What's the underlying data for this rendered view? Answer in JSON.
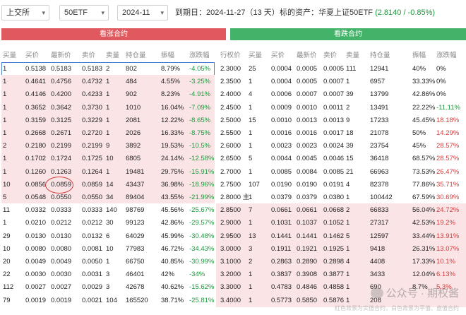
{
  "topbar": {
    "exchange": "上交所",
    "underlying": "50ETF",
    "month": "2024-11",
    "expiry_label": "到期日：",
    "expiry_date": "2024-11-27",
    "days_left": "（13 天）",
    "asset_label": "标的资产：",
    "asset_name": "华夏上证50ETF",
    "asset_quote": "(2.8140 / -0.85%)"
  },
  "headers": {
    "call": "看涨合约",
    "put": "看跌合约"
  },
  "call_columns": [
    "买量",
    "买价",
    "最新价",
    "卖价",
    "卖量",
    "持仓量",
    "振幅",
    "涨跌幅"
  ],
  "put_columns": [
    "行权价",
    "买量",
    "买价",
    "最新价",
    "卖价",
    "卖量",
    "持仓量",
    "振幅",
    "涨跌幅"
  ],
  "calls": [
    [
      "1",
      "0.5138",
      "0.5183",
      "0.5183",
      "2",
      "802",
      "8.79%",
      "-4.05%"
    ],
    [
      "1",
      "0.4641",
      "0.4756",
      "0.4732",
      "1",
      "484",
      "4.55%",
      "-3.25%"
    ],
    [
      "1",
      "0.4146",
      "0.4200",
      "0.4233",
      "1",
      "902",
      "8.23%",
      "-4.91%"
    ],
    [
      "1",
      "0.3652",
      "0.3642",
      "0.3730",
      "1",
      "1010",
      "16.04%",
      "-7.09%"
    ],
    [
      "1",
      "0.3159",
      "0.3125",
      "0.3229",
      "1",
      "2081",
      "12.22%",
      "-8.65%"
    ],
    [
      "1",
      "0.2668",
      "0.2671",
      "0.2720",
      "1",
      "2026",
      "16.33%",
      "-8.75%"
    ],
    [
      "2",
      "0.2180",
      "0.2199",
      "0.2199",
      "9",
      "3892",
      "19.53%",
      "-10.5%"
    ],
    [
      "1",
      "0.1702",
      "0.1724",
      "0.1725",
      "10",
      "6805",
      "24.14%",
      "-12.58%"
    ],
    [
      "1",
      "0.1260",
      "0.1263",
      "0.1264",
      "1",
      "19481",
      "29.75%",
      "-15.91%"
    ],
    [
      "10",
      "0.0856",
      "0.0859",
      "0.0859",
      "14",
      "43437",
      "36.98%",
      "-18.96%"
    ],
    [
      "5",
      "0.0548",
      "0.0550",
      "0.0550",
      "34",
      "89404",
      "43.55%",
      "-21.99%"
    ],
    [
      "11",
      "0.0332",
      "0.0333",
      "0.0333",
      "140",
      "98769",
      "45.56%",
      "-25.67%"
    ],
    [
      "1",
      "0.0210",
      "0.0212",
      "0.0212",
      "30",
      "99123",
      "42.86%",
      "-29.57%"
    ],
    [
      "29",
      "0.0130",
      "0.0130",
      "0.0132",
      "6",
      "64029",
      "45.99%",
      "-30.48%"
    ],
    [
      "10",
      "0.0080",
      "0.0080",
      "0.0081",
      "10",
      "77983",
      "46.72%",
      "-34.43%"
    ],
    [
      "20",
      "0.0049",
      "0.0049",
      "0.0050",
      "1",
      "66750",
      "40.85%",
      "-30.99%"
    ],
    [
      "22",
      "0.0030",
      "0.0030",
      "0.0031",
      "3",
      "46401",
      "42%",
      "-34%"
    ],
    [
      "112",
      "0.0027",
      "0.0027",
      "0.0029",
      "3",
      "42678",
      "40.62%",
      "-15.62%"
    ],
    [
      "79",
      "0.0019",
      "0.0019",
      "0.0021",
      "104",
      "165520",
      "38.71%",
      "-25.81%"
    ]
  ],
  "puts": [
    [
      "2.3000",
      "25",
      "0.0004",
      "0.0005",
      "0.0005",
      "111",
      "12941",
      "40%",
      "0%"
    ],
    [
      "2.3500",
      "1",
      "0.0004",
      "0.0005",
      "0.0007",
      "1",
      "6957",
      "33.33%",
      "0%"
    ],
    [
      "2.4000",
      "4",
      "0.0006",
      "0.0007",
      "0.0007",
      "39",
      "13799",
      "42.86%",
      "0%"
    ],
    [
      "2.4500",
      "1",
      "0.0009",
      "0.0010",
      "0.0011",
      "2",
      "13491",
      "22.22%",
      "-11.11%"
    ],
    [
      "2.5000",
      "15",
      "0.0010",
      "0.0013",
      "0.0013",
      "9",
      "17233",
      "45.45%",
      "18.18%"
    ],
    [
      "2.5500",
      "1",
      "0.0016",
      "0.0016",
      "0.0017",
      "18",
      "21078",
      "50%",
      "14.29%"
    ],
    [
      "2.6000",
      "1",
      "0.0023",
      "0.0023",
      "0.0024",
      "39",
      "23754",
      "45%",
      "28.57%"
    ],
    [
      "2.6500",
      "5",
      "0.0044",
      "0.0045",
      "0.0046",
      "15",
      "36418",
      "68.57%",
      "28.57%"
    ],
    [
      "2.7000",
      "1",
      "0.0085",
      "0.0084",
      "0.0085",
      "21",
      "66963",
      "73.53%",
      "26.47%"
    ],
    [
      "2.7500",
      "107",
      "0.0190",
      "0.0190",
      "0.0191",
      "4",
      "82378",
      "77.86%",
      "35.71%"
    ],
    [
      "2.8000 主",
      "1",
      "0.0379",
      "0.0379",
      "0.0380",
      "1",
      "100442",
      "67.59%",
      "30.69%"
    ],
    [
      "2.8500",
      "7",
      "0.0661",
      "0.0661",
      "0.0668",
      "2",
      "66833",
      "56.04%",
      "24.72%"
    ],
    [
      "2.9000",
      "1",
      "0.1031",
      "0.1037",
      "0.1052",
      "1",
      "27317",
      "42.53%",
      "19.2%"
    ],
    [
      "2.9500",
      "13",
      "0.1441",
      "0.1441",
      "0.1462",
      "5",
      "12597",
      "33.44%",
      "13.91%"
    ],
    [
      "3.0000",
      "3",
      "0.1911",
      "0.1921",
      "0.1925",
      "1",
      "9418",
      "26.31%",
      "13.07%"
    ],
    [
      "3.1000",
      "2",
      "0.2863",
      "0.2890",
      "0.2898",
      "4",
      "4408",
      "17.33%",
      "10.1%"
    ],
    [
      "3.2000",
      "1",
      "0.3837",
      "0.3908",
      "0.3877",
      "1",
      "3433",
      "12.04%",
      "6.13%"
    ],
    [
      "3.3000",
      "1",
      "0.4783",
      "0.4846",
      "0.4858",
      "1",
      "690",
      "8.7%",
      "5.3%"
    ],
    [
      "3.4000",
      "1",
      "0.5773",
      "0.5850",
      "0.5876",
      "1",
      "208",
      "",
      ""
    ]
  ],
  "watermark": "公众号 · 期权酱",
  "watermark_sub": "红色背景为实值合约，白色背景为平值、虚值合约",
  "colors": {
    "call_header": "#e0595e",
    "put_header": "#43b36a",
    "itm_bg": "#fbe4e6",
    "up": "#d23c3c",
    "down": "#1a9a3c"
  }
}
